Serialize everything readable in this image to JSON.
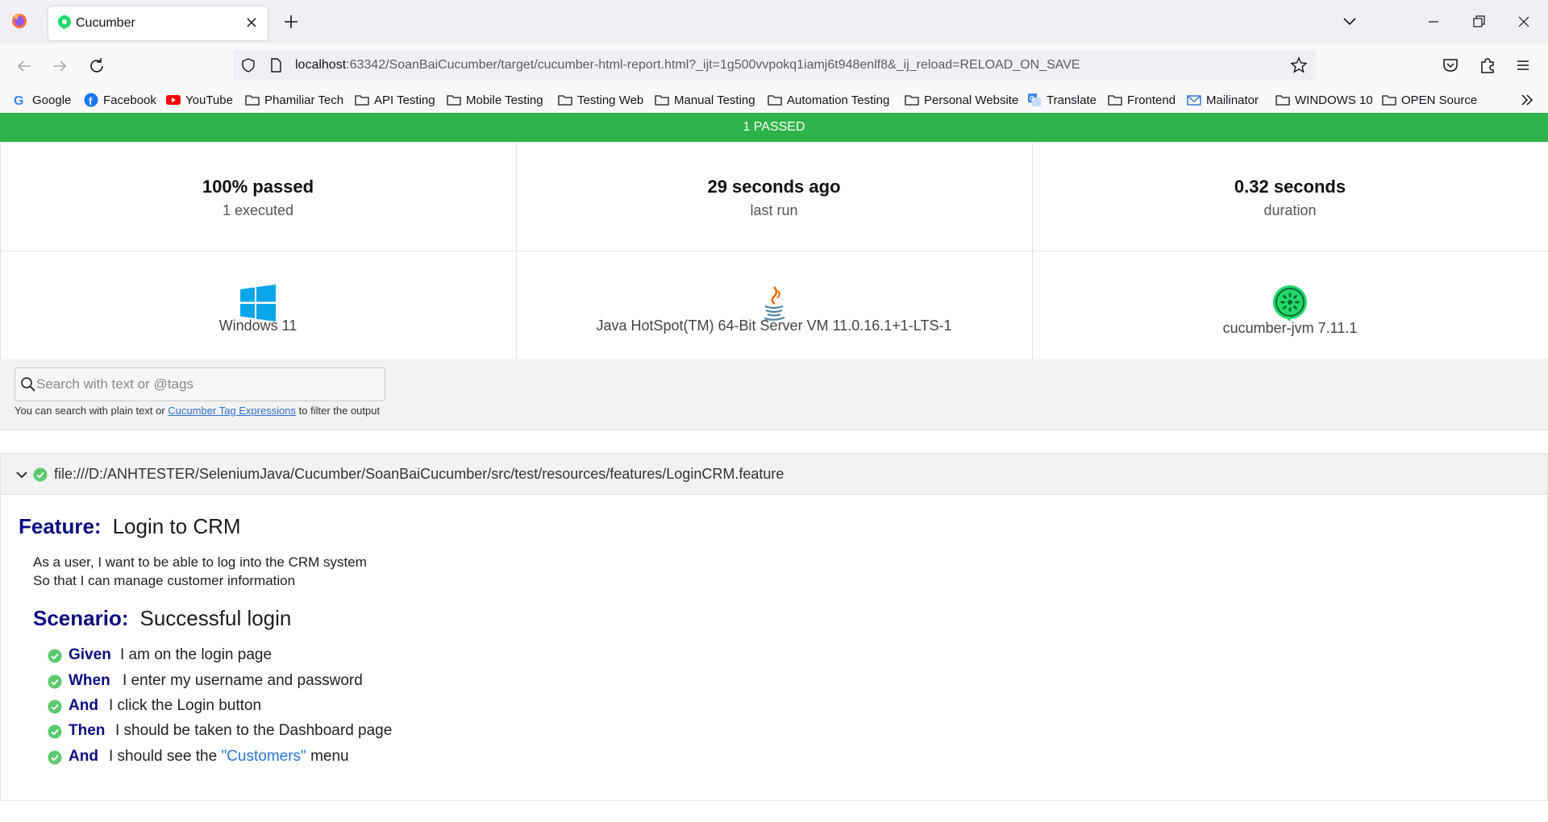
{
  "browser": {
    "tab_title": "Cucumber",
    "url_host": "localhost",
    "url_rest": ":63342/SoanBaiCucumber/target/cucumber-html-report.html?_ijt=1g500vvpokq1iamj6t948enlf8&_ij_reload=RELOAD_ON_SAVE"
  },
  "bookmarks": [
    {
      "label": "Google",
      "icon": "google-icon"
    },
    {
      "label": "Facebook",
      "icon": "facebook-icon"
    },
    {
      "label": "YouTube",
      "icon": "youtube-icon"
    },
    {
      "label": "Phamiliar Tech",
      "icon": "folder-icon"
    },
    {
      "label": "API Testing",
      "icon": "folder-icon"
    },
    {
      "label": "Mobile Testing",
      "icon": "folder-icon"
    },
    {
      "label": "Testing Web",
      "icon": "folder-icon"
    },
    {
      "label": "Manual Testing",
      "icon": "folder-icon"
    },
    {
      "label": "Automation Testing",
      "icon": "folder-icon"
    },
    {
      "label": "Personal Website",
      "icon": "folder-icon"
    },
    {
      "label": "Translate",
      "icon": "translate-icon"
    },
    {
      "label": "Frontend",
      "icon": "folder-icon"
    },
    {
      "label": "Mailinator",
      "icon": "mail-icon"
    },
    {
      "label": "WINDOWS 10",
      "icon": "folder-icon"
    },
    {
      "label": "OPEN Source",
      "icon": "folder-icon"
    }
  ],
  "report": {
    "status_banner": "1 PASSED",
    "stats": [
      {
        "value": "100% passed",
        "label": "1 executed"
      },
      {
        "value": "29 seconds ago",
        "label": "last run"
      },
      {
        "value": "0.32 seconds",
        "label": "duration"
      }
    ],
    "env": [
      {
        "label": "Windows 11",
        "icon": "windows-icon"
      },
      {
        "label": "Java HotSpot(TM) 64-Bit Server VM 11.0.16.1+1-LTS-1",
        "icon": "java-icon"
      },
      {
        "label": "cucumber-jvm 7.11.1",
        "icon": "cucumber-icon"
      }
    ],
    "search": {
      "placeholder": "Search with text or @tags",
      "help_before": "You can search with plain text or ",
      "help_link": "Cucumber Tag Expressions",
      "help_after": " to filter the output"
    },
    "feature": {
      "path": "file:///D:/ANHTESTER/SeleniumJava/Cucumber/SoanBaiCucumber/src/test/resources/features/LoginCRM.feature",
      "keyword": "Feature:",
      "name": "Login to CRM",
      "description": [
        "As a user, I want to be able to log into the CRM system",
        "So that I can manage customer information"
      ],
      "scenario": {
        "keyword": "Scenario:",
        "name": "Successful login",
        "steps": [
          {
            "keyword": "Given",
            "text": "I am on the login page"
          },
          {
            "keyword": "When",
            "text": "I enter my username and password"
          },
          {
            "keyword": "And",
            "text": "I click the Login button"
          },
          {
            "keyword": "Then",
            "text": "I should be taken to the Dashboard page"
          },
          {
            "keyword": "And",
            "text_before": "I should see the ",
            "param": "\"Customers\"",
            "text_after": " menu"
          }
        ]
      }
    }
  },
  "colors": {
    "passed": "#2eb34b",
    "keyword": "#0b0b82",
    "param": "#2a78d6"
  }
}
